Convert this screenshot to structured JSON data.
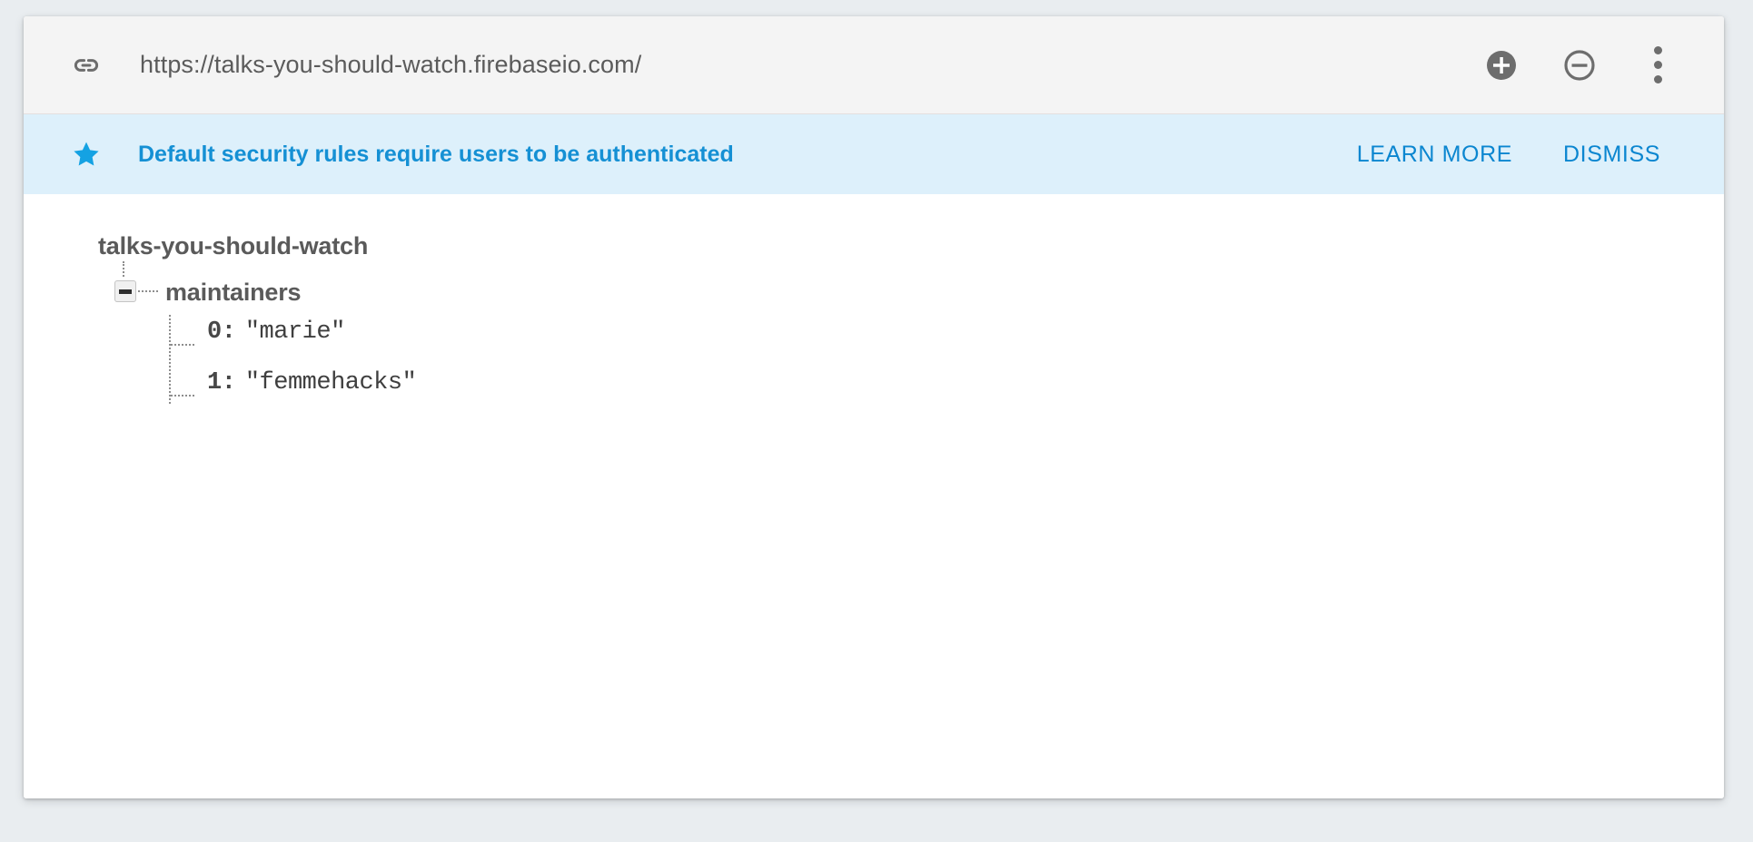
{
  "urlbar": {
    "link_icon": "link-icon",
    "url": "https://talks-you-should-watch.firebaseio.com/",
    "add_icon": "plus-circle-icon",
    "remove_icon": "minus-circle-icon",
    "menu_icon": "kebab-menu-icon"
  },
  "banner": {
    "icon": "star-icon",
    "message": "Default security rules require users to be authenticated",
    "learn_more_label": "LEARN MORE",
    "dismiss_label": "DISMISS",
    "background_color": "#ddf0fb",
    "text_color": "#1590d4",
    "accent_color": "#14a2e3"
  },
  "tree": {
    "root_label": "talks-you-should-watch",
    "node": {
      "label": "maintainers",
      "toggle_state": "expanded",
      "toggle_icon": "minus-toggle-icon",
      "children": [
        {
          "key": "0:",
          "value": "\"marie\""
        },
        {
          "key": "1:",
          "value": "\"femmehacks\""
        }
      ]
    }
  }
}
